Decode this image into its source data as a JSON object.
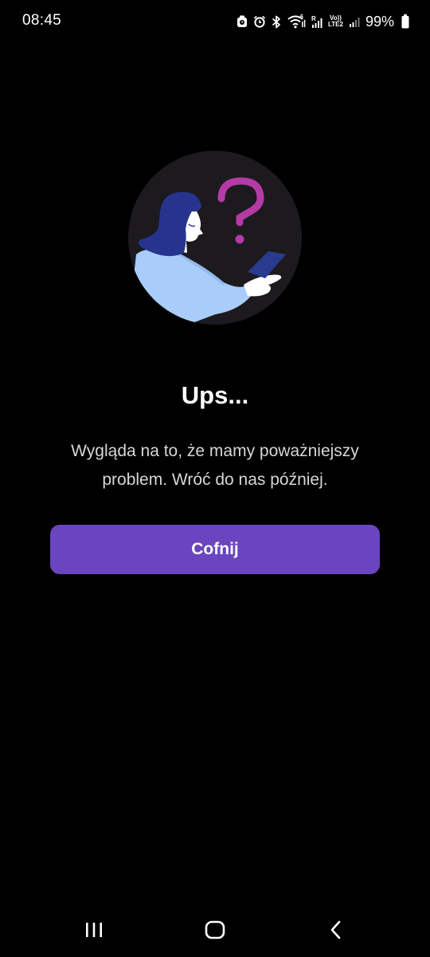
{
  "status_bar": {
    "time": "08:45",
    "battery_percent": "99%",
    "icons": [
      "alarm-clock-icon",
      "alarm-icon",
      "bluetooth-icon",
      "wifi-icon",
      "signal-icon",
      "volte-lte2-icon",
      "signal-2-icon",
      "battery-icon"
    ],
    "lte_top": "Vo))",
    "lte_bottom": "LTE2"
  },
  "error": {
    "title": "Ups...",
    "message": "Wygląda na to, że mamy poważniejszy problem. Wróć do nas później."
  },
  "actions": {
    "back_label": "Cofnij"
  },
  "colors": {
    "background": "#000000",
    "accent": "#6a45bf",
    "question_mark": "#b43aa6",
    "illustration_bg": "#1c1a1f",
    "hair": "#27348f",
    "sleeve": "#a9cdf8",
    "phone": "#2a3a8e"
  },
  "nav_bar": {
    "icons": [
      "recent-apps-icon",
      "home-icon",
      "back-icon"
    ]
  }
}
